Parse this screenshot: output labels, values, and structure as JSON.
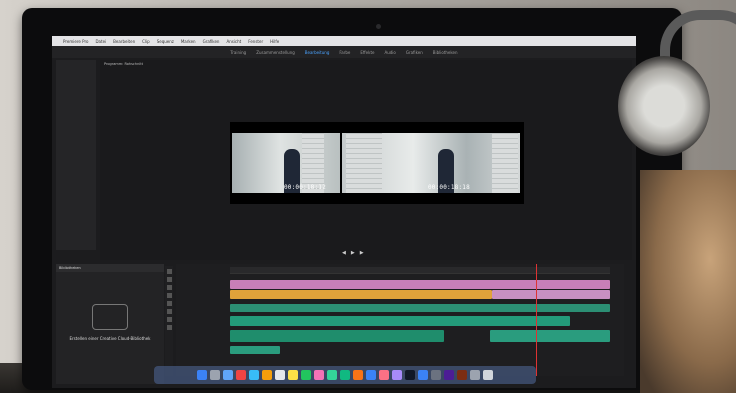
{
  "scene": {
    "app_title": "Premiere Pro",
    "menu_items": [
      "Datei",
      "Bearbeiten",
      "Clip",
      "Sequenz",
      "Marken",
      "Grafiken",
      "Ansicht",
      "Fenster",
      "Hilfe"
    ],
    "workspace_tabs": [
      "Training",
      "Zusammenstellung",
      "Bearbeitung",
      "Farbe",
      "Effekte",
      "Audio",
      "Grafiken",
      "Bibliotheken"
    ],
    "active_workspace": "Bearbeitung",
    "program_panel_label": "Programm: Rohschnitt",
    "timecode_left": "00:00:18:12",
    "timecode_right": "00:00:18:18",
    "library_panel_title": "Bibliotheken",
    "library_caption": "Erstellen einer Creative Cloud-Bibliothek"
  }
}
